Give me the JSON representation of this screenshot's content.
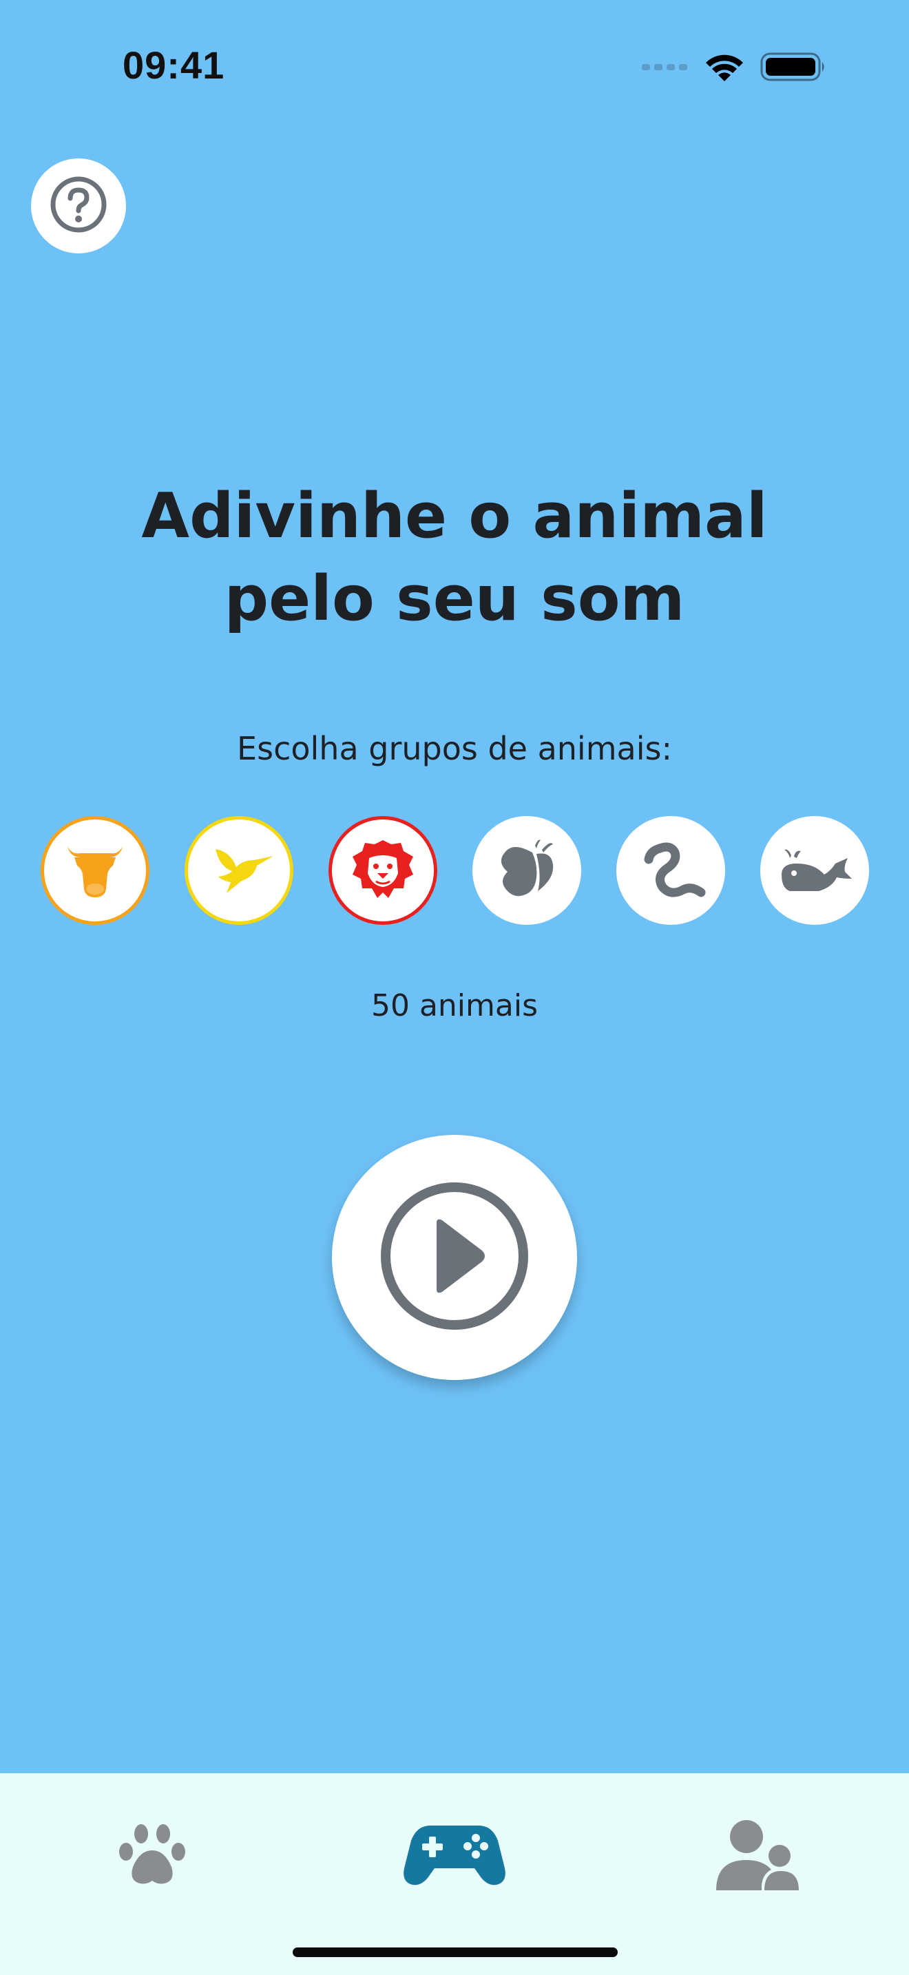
{
  "status_bar": {
    "time": "09:41",
    "icons": [
      "cellular-signal-icon",
      "wifi-icon",
      "battery-icon"
    ]
  },
  "help_button": {
    "icon": "question-circle-icon"
  },
  "title": {
    "line1": "Adivinhe o animal",
    "line2": "pelo seu som"
  },
  "groups_prompt": "Escolha grupos de animais:",
  "animal_groups": [
    {
      "icon": "cow-icon",
      "selected": true,
      "color": "#f7a21b"
    },
    {
      "icon": "hummingbird-icon",
      "selected": true,
      "color": "#f5d70f"
    },
    {
      "icon": "lion-icon",
      "selected": true,
      "color": "#e8201e"
    },
    {
      "icon": "butterfly-icon",
      "selected": false,
      "color": "#6a7178"
    },
    {
      "icon": "snake-icon",
      "selected": false,
      "color": "#6a7178"
    },
    {
      "icon": "whale-icon",
      "selected": false,
      "color": "#6a7178"
    }
  ],
  "animal_count": "50 animais",
  "play_button": {
    "icon": "play-circle-icon"
  },
  "tab_bar": {
    "tabs": [
      {
        "icon": "paw-icon",
        "active": false
      },
      {
        "icon": "gamepad-icon",
        "active": true
      },
      {
        "icon": "users-icon",
        "active": false
      }
    ]
  },
  "colors": {
    "background": "#6ec1f7",
    "tabbar_background": "#e8fcfc",
    "active_tab": "#1478a0",
    "inactive_tab": "#8a8d90",
    "icon_gray": "#6a7178",
    "text": "#1d2126"
  }
}
